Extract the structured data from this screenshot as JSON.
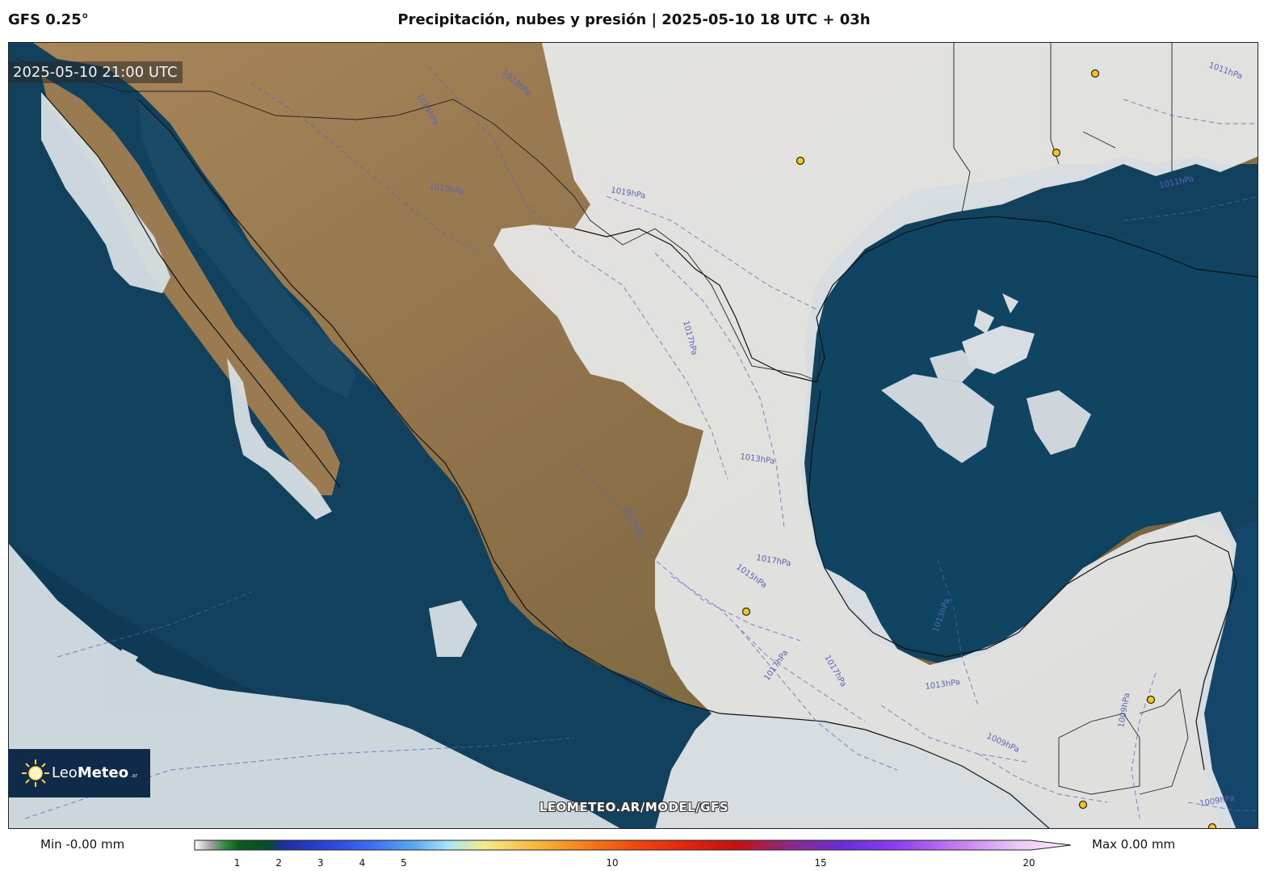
{
  "header": {
    "model": "GFS 0.25°",
    "title": "Precipitación, nubes y presión | 2025-05-10 18 UTC + 03h"
  },
  "map": {
    "timestamp": "2025-05-10 21:00 UTC",
    "watermark": "LEOMETEO.AR/MODEL/GFS",
    "logo": {
      "brand_light": "Leo",
      "brand_bold": "Meteo",
      "tld": ".ar",
      "icon": "sun-icon"
    },
    "isobars": [
      {
        "label": "1011hPa"
      },
      {
        "label": "1011hPa"
      },
      {
        "label": "1013hPa"
      },
      {
        "label": "1013hPa"
      },
      {
        "label": "1013hPa"
      },
      {
        "label": "1015hPa"
      },
      {
        "label": "1017hPa"
      },
      {
        "label": "1017hPa"
      },
      {
        "label": "1017hPa"
      },
      {
        "label": "1017hPa"
      },
      {
        "label": "1017hPa"
      },
      {
        "label": "1019hPa"
      },
      {
        "label": "1019hPa"
      },
      {
        "label": "1019hPa"
      },
      {
        "label": "1023hPa"
      },
      {
        "label": "1009hPa"
      },
      {
        "label": "1009hPa"
      },
      {
        "label": "1009hPa"
      }
    ],
    "colors": {
      "ocean": "#12415e",
      "land": "#8a6e47",
      "cloud": "#e6e8e9",
      "isobar": "#5b63b5"
    }
  },
  "colorbar": {
    "min_label": "Min -0.00 mm",
    "max_label": "Max 0.00 mm",
    "ticks": [
      "1",
      "2",
      "3",
      "4",
      "5",
      "10",
      "15",
      "20"
    ],
    "tick_values": [
      1,
      2,
      3,
      4,
      5,
      10,
      15,
      20
    ],
    "range": [
      0,
      20
    ]
  }
}
